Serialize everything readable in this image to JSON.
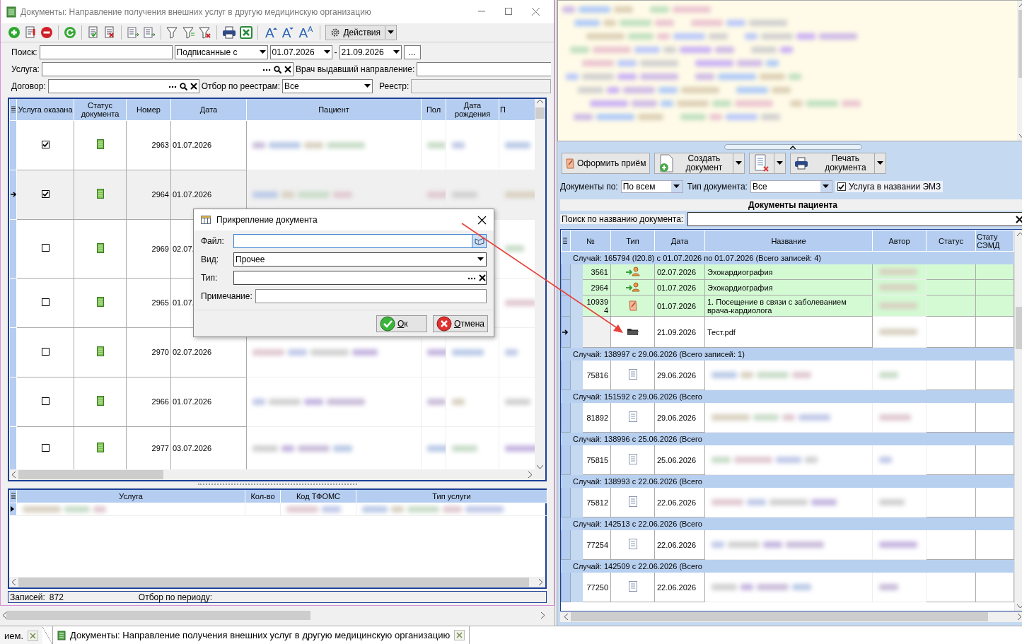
{
  "main_window": {
    "title": "Документы: Направление получения внешних услуг в другую медицинскую организацию",
    "toolbar": {
      "font_buttons": [
        {
          "label": "A",
          "kind": "grow"
        },
        {
          "label": "A",
          "kind": "shrink"
        },
        {
          "label": "A$^{A}$",
          "kind": "reset"
        }
      ],
      "actions_button": "Действия"
    },
    "filters": {
      "search_label": "Поиск:",
      "signed_mode": "Подписанные с",
      "date_from": "01.07.2026",
      "date_separator": "-",
      "date_to": "21.09.2026",
      "period_button": "...",
      "service_label": "Услуга:",
      "doctor_label": "Врач выдавший направление:",
      "contract_label": "Договор:",
      "registry_filter_label": "Отбор по реестрам:",
      "registry_filter_value": "Все",
      "registry_label": "Реестр:"
    },
    "table": {
      "columns": [
        "Услуга оказана",
        "Статус документа",
        "Номер",
        "Дата",
        "Пациент",
        "Пол",
        "Дата рождения",
        "П"
      ],
      "rows": [
        {
          "service_done": true,
          "number": "2963",
          "date": "01.07.2026",
          "selected": false
        },
        {
          "service_done": true,
          "number": "2964",
          "date": "01.07.2026",
          "selected": true
        },
        {
          "service_done": false,
          "number": "2969",
          "date": "02.07.",
          "selected": false
        },
        {
          "service_done": false,
          "number": "2965",
          "date": "01.07.",
          "selected": false
        },
        {
          "service_done": false,
          "number": "2970",
          "date": "02.07.2026",
          "selected": false
        },
        {
          "service_done": false,
          "number": "2966",
          "date": "01.07.2026",
          "selected": false
        },
        {
          "service_done": false,
          "number": "2977",
          "date": "03.07.2026",
          "selected": false
        }
      ]
    },
    "detail_table": {
      "columns": [
        "Услуга",
        "Кол-во",
        "Код ТФОМС",
        "Тип услуги"
      ]
    },
    "status_bar": {
      "records_label": "Записей:",
      "records_count": "872",
      "period_label": "Отбор по периоду:"
    }
  },
  "documents_panel": {
    "buttons": [
      {
        "label": "Оформить приём",
        "kind": "visit",
        "menu": false
      },
      {
        "label": "Создать документ",
        "kind": "create",
        "menu": true
      },
      {
        "kind": "delete",
        "menu": true
      },
      {
        "label": "Печать документа",
        "kind": "print",
        "menu": true
      }
    ],
    "filters": {
      "docs_by_label": "Документы по:",
      "docs_by_value": "По всем",
      "doc_type_label": "Тип документа:",
      "doc_type_value": "Все",
      "service_in_name": {
        "label": "Услуга в названии ЭМЗ",
        "checked": true
      }
    },
    "title": "Документы пациента",
    "search_label": "Поиск по названию документа:",
    "table": {
      "columns": [
        "№",
        "Тип",
        "Дата",
        "Название",
        "Автор",
        "Статус",
        "Стату СЭМД"
      ],
      "groups": [
        {
          "header": "Случай: 165794 (I20.8) с 01.07.2026  по 01.07.2026 (Всего записей: 4)",
          "rows": [
            {
              "number": "3561",
              "kind": "referral",
              "date": "02.07.2026",
              "name": "Эхокардиография",
              "highlighted": true,
              "selected": false
            },
            {
              "number": "2964",
              "kind": "referral",
              "date": "01.07.2026",
              "name": "Эхокардиография",
              "highlighted": true,
              "selected": false
            },
            {
              "number": "109394",
              "kind": "visit",
              "date": "01.07.2026",
              "name": "1. Посещение в связи с заболеванием врача-кардиолога",
              "highlighted": true,
              "selected": false
            },
            {
              "kind": "folder",
              "date": "21.09.2026",
              "name": "Тест.pdf",
              "highlighted": false,
              "selected": true
            }
          ]
        },
        {
          "header": "Случай: 138997 с 29.06.2026  (Всего записей: 1)",
          "rows": [
            {
              "number": "75816",
              "kind": "document",
              "date": "29.06.2026",
              "highlighted": false,
              "selected": false
            }
          ]
        },
        {
          "header": "Случай: 151592 с 29.06.2026  (Всего",
          "rows": [
            {
              "number": "81892",
              "kind": "document",
              "date": "29.06.2026",
              "highlighted": false,
              "selected": false
            }
          ]
        },
        {
          "header": "Случай: 138996 с 25.06.2026  (Всего",
          "rows": [
            {
              "number": "75815",
              "kind": "document",
              "date": "25.06.2026",
              "highlighted": false,
              "selected": false
            }
          ]
        },
        {
          "header": "Случай: 138993 с 22.06.2026  (Всего",
          "rows": [
            {
              "number": "75812",
              "kind": "document",
              "date": "22.06.2026",
              "highlighted": false,
              "selected": false
            }
          ]
        },
        {
          "header": "Случай: 142513 с 22.06.2026  (Всего",
          "rows": [
            {
              "number": "77254",
              "kind": "document",
              "date": "22.06.2026",
              "highlighted": false,
              "selected": false
            }
          ]
        },
        {
          "header": "Случай: 142509 с 22.06.2026  (Всего",
          "rows": [
            {
              "number": "77250",
              "kind": "document",
              "date": "22.06.2026",
              "highlighted": false,
              "selected": false
            }
          ]
        }
      ]
    }
  },
  "dialog": {
    "title": "Прикрепление документа",
    "fields": [
      {
        "label": "Файл:",
        "kind": "file"
      },
      {
        "label": "Вид:",
        "kind": "select",
        "value": "Прочее"
      },
      {
        "label": "Тип:",
        "kind": "lookup"
      },
      {
        "label": "Примечание:",
        "kind": "text"
      }
    ],
    "buttons": [
      {
        "label": "Ок",
        "kind": "ok"
      },
      {
        "label": "Отмена",
        "kind": "cancel"
      }
    ]
  },
  "taskbar": {
    "tabs": [
      {
        "label": "ием.",
        "selected": false
      },
      {
        "label": "Документы: Направление получения внешних услуг в другую медицинскую организацию",
        "selected": true
      }
    ]
  }
}
